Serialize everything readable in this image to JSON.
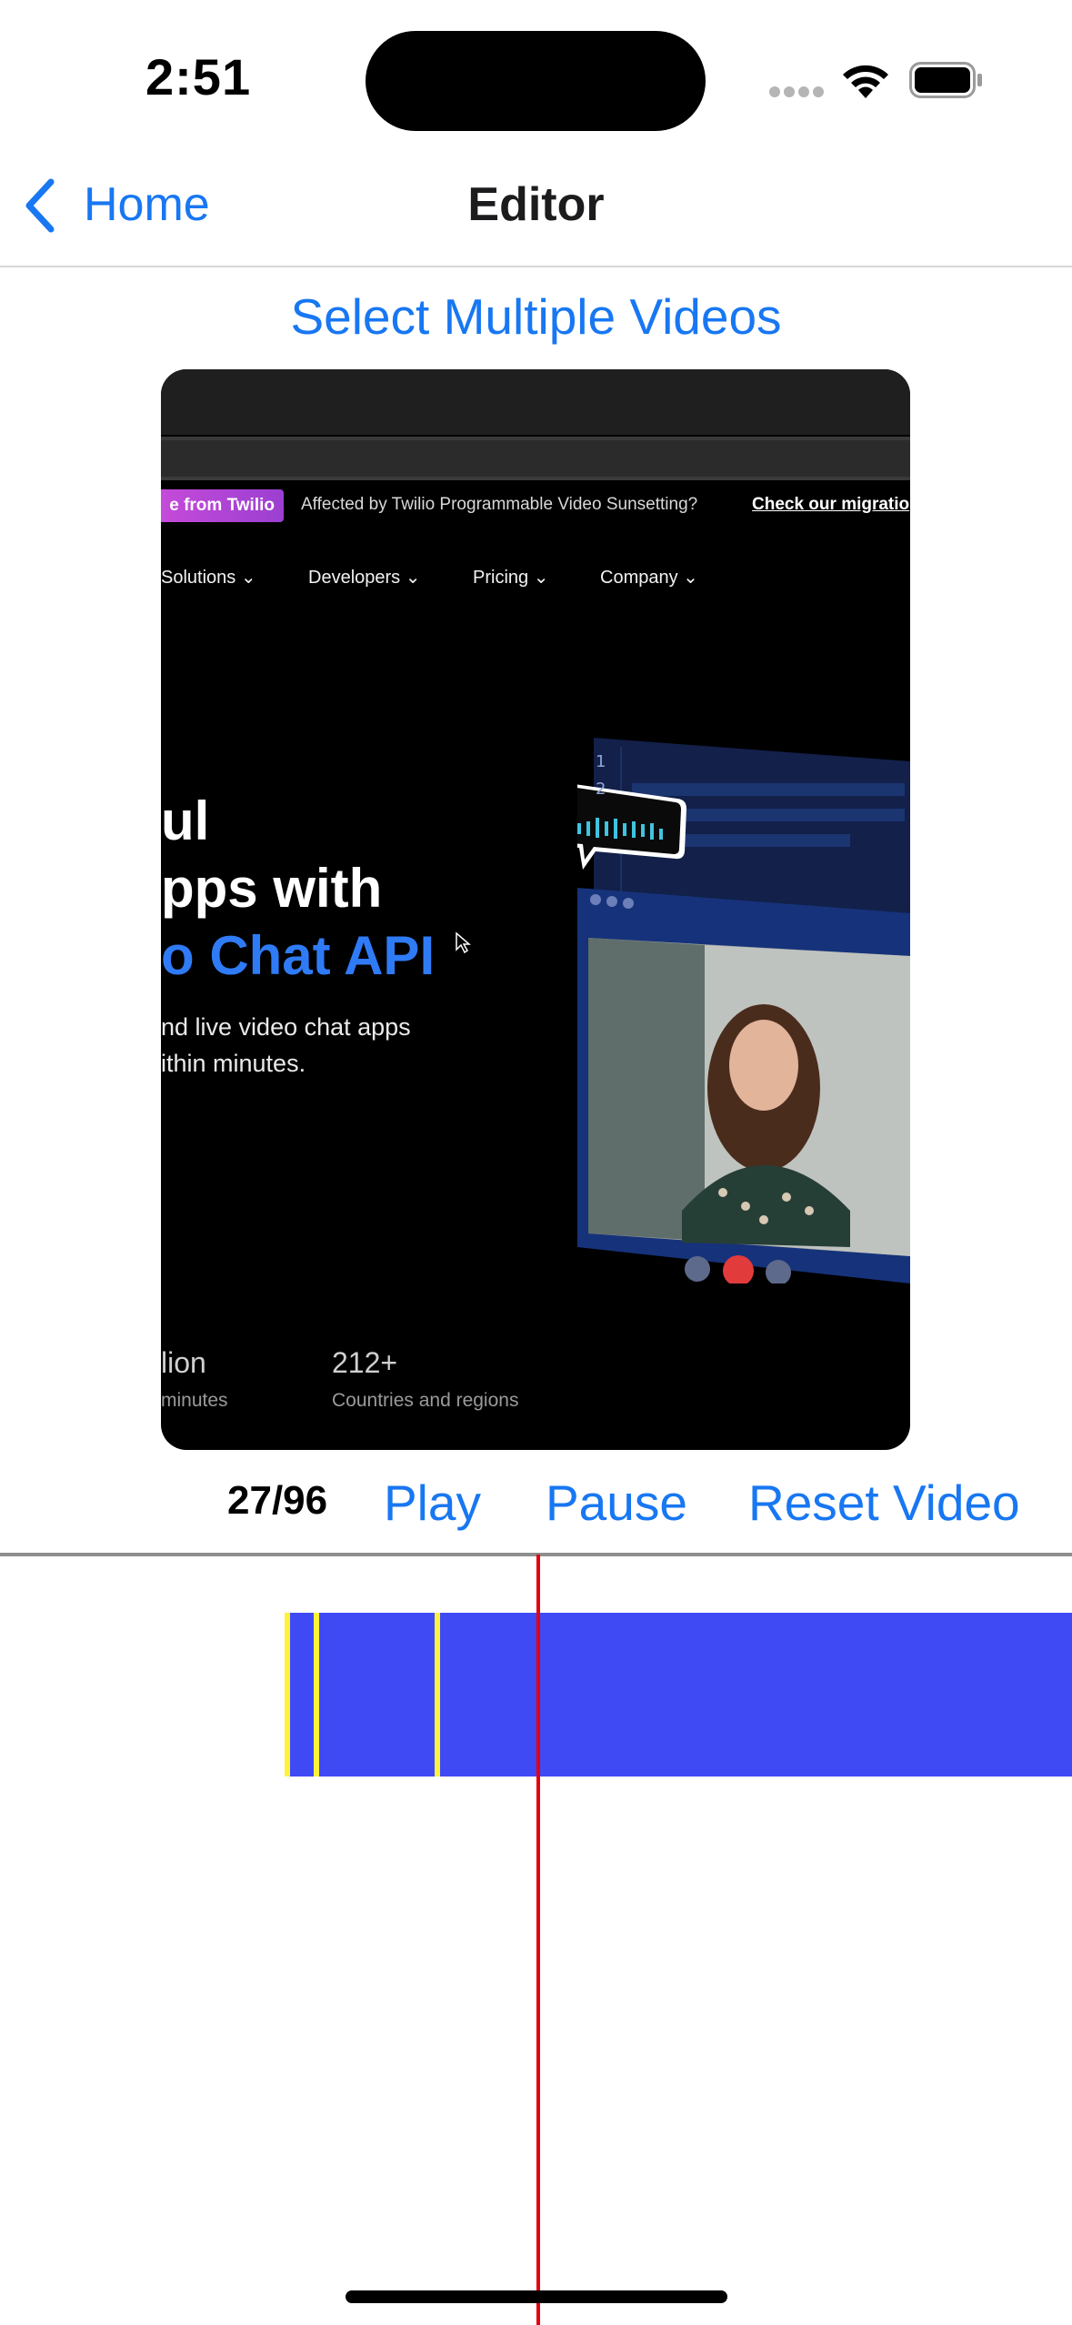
{
  "status_bar": {
    "time": "2:51"
  },
  "nav": {
    "back_label": "Home",
    "title": "Editor"
  },
  "select_videos_label": "Select Multiple Videos",
  "video_preview": {
    "promo_tag": "e from Twilio",
    "promo_text": "Affected by Twilio Programmable Video Sunsetting?",
    "promo_link": "Check our migratio",
    "menu": [
      "Solutions",
      "Developers",
      "Pricing",
      "Company"
    ],
    "hero_lines": [
      "ul",
      "pps with",
      "o Chat API"
    ],
    "hero_sub": [
      "nd live video chat apps",
      "ithin minutes."
    ],
    "stats": [
      {
        "number": "lion",
        "label": "minutes"
      },
      {
        "number": "212+",
        "label": "Countries and regions"
      }
    ],
    "code_lines": [
      "1",
      "2"
    ]
  },
  "controls": {
    "frame_counter": "27/96",
    "play_label": "Play",
    "pause_label": "Pause",
    "reset_label": "Reset Video"
  },
  "colors": {
    "accent": "#1877f2",
    "clip": "#3f4af5",
    "marker": "#fff23a",
    "playhead": "#e3000f"
  }
}
